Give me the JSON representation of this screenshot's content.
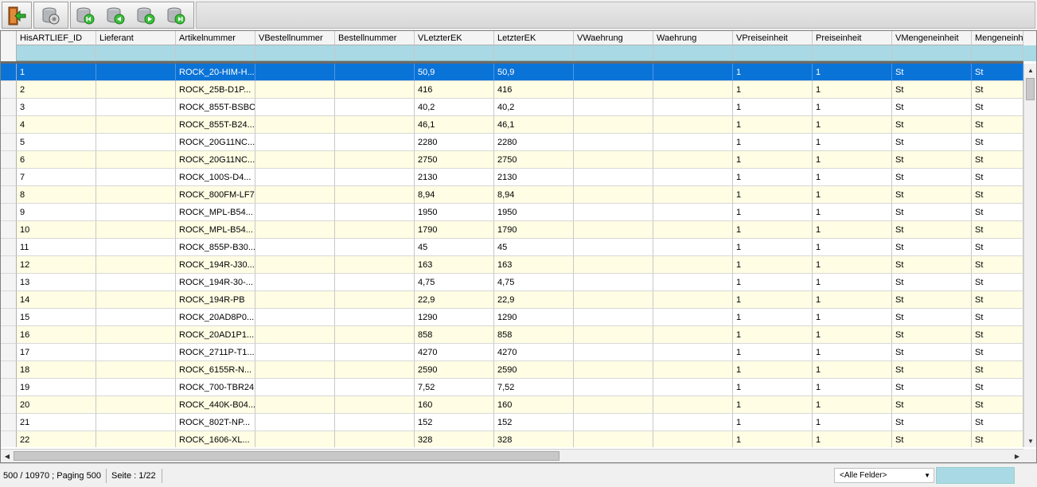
{
  "toolbar": {
    "buttons": [
      {
        "name": "exit-button",
        "icon": "exit-door-icon"
      },
      {
        "name": "settings-db-button",
        "icon": "database-gear-icon"
      },
      {
        "name": "first-page-button",
        "icon": "database-first-icon"
      },
      {
        "name": "previous-page-button",
        "icon": "database-previous-icon"
      },
      {
        "name": "next-page-button",
        "icon": "database-next-icon"
      },
      {
        "name": "last-page-button",
        "icon": "database-last-icon"
      }
    ]
  },
  "grid": {
    "columns": [
      "HisARTLIEF_ID",
      "Lieferant",
      "Artikelnummer",
      "VBestellnummer",
      "Bestellnummer",
      "VLetzterEK",
      "LetzterEK",
      "VWaehrung",
      "Waehrung",
      "VPreiseinheit",
      "Preiseinheit",
      "VMengeneinheit",
      "Mengeneinh"
    ],
    "rows": [
      [
        "1",
        "",
        "ROCK_20-HIM-H...",
        "",
        "",
        "50,9",
        "50,9",
        "",
        "",
        "1",
        "1",
        "St",
        "St"
      ],
      [
        "2",
        "",
        "ROCK_25B-D1P...",
        "",
        "",
        "416",
        "416",
        "",
        "",
        "1",
        "1",
        "St",
        "St"
      ],
      [
        "3",
        "",
        "ROCK_855T-BSBC",
        "",
        "",
        "40,2",
        "40,2",
        "",
        "",
        "1",
        "1",
        "St",
        "St"
      ],
      [
        "4",
        "",
        "ROCK_855T-B24...",
        "",
        "",
        "46,1",
        "46,1",
        "",
        "",
        "1",
        "1",
        "St",
        "St"
      ],
      [
        "5",
        "",
        "ROCK_20G11NC...",
        "",
        "",
        "2280",
        "2280",
        "",
        "",
        "1",
        "1",
        "St",
        "St"
      ],
      [
        "6",
        "",
        "ROCK_20G11NC...",
        "",
        "",
        "2750",
        "2750",
        "",
        "",
        "1",
        "1",
        "St",
        "St"
      ],
      [
        "7",
        "",
        "ROCK_100S-D4...",
        "",
        "",
        "2130",
        "2130",
        "",
        "",
        "1",
        "1",
        "St",
        "St"
      ],
      [
        "8",
        "",
        "ROCK_800FM-LF7",
        "",
        "",
        "8,94",
        "8,94",
        "",
        "",
        "1",
        "1",
        "St",
        "St"
      ],
      [
        "9",
        "",
        "ROCK_MPL-B54...",
        "",
        "",
        "1950",
        "1950",
        "",
        "",
        "1",
        "1",
        "St",
        "St"
      ],
      [
        "10",
        "",
        "ROCK_MPL-B54...",
        "",
        "",
        "1790",
        "1790",
        "",
        "",
        "1",
        "1",
        "St",
        "St"
      ],
      [
        "11",
        "",
        "ROCK_855P-B30...",
        "",
        "",
        "45",
        "45",
        "",
        "",
        "1",
        "1",
        "St",
        "St"
      ],
      [
        "12",
        "",
        "ROCK_194R-J30...",
        "",
        "",
        "163",
        "163",
        "",
        "",
        "1",
        "1",
        "St",
        "St"
      ],
      [
        "13",
        "",
        "ROCK_194R-30-...",
        "",
        "",
        "4,75",
        "4,75",
        "",
        "",
        "1",
        "1",
        "St",
        "St"
      ],
      [
        "14",
        "",
        "ROCK_194R-PB",
        "",
        "",
        "22,9",
        "22,9",
        "",
        "",
        "1",
        "1",
        "St",
        "St"
      ],
      [
        "15",
        "",
        "ROCK_20AD8P0...",
        "",
        "",
        "1290",
        "1290",
        "",
        "",
        "1",
        "1",
        "St",
        "St"
      ],
      [
        "16",
        "",
        "ROCK_20AD1P1...",
        "",
        "",
        "858",
        "858",
        "",
        "",
        "1",
        "1",
        "St",
        "St"
      ],
      [
        "17",
        "",
        "ROCK_2711P-T1...",
        "",
        "",
        "4270",
        "4270",
        "",
        "",
        "1",
        "1",
        "St",
        "St"
      ],
      [
        "18",
        "",
        "ROCK_6155R-N...",
        "",
        "",
        "2590",
        "2590",
        "",
        "",
        "1",
        "1",
        "St",
        "St"
      ],
      [
        "19",
        "",
        "ROCK_700-TBR24",
        "",
        "",
        "7,52",
        "7,52",
        "",
        "",
        "1",
        "1",
        "St",
        "St"
      ],
      [
        "20",
        "",
        "ROCK_440K-B04...",
        "",
        "",
        "160",
        "160",
        "",
        "",
        "1",
        "1",
        "St",
        "St"
      ],
      [
        "21",
        "",
        "ROCK_802T-NP...",
        "",
        "",
        "152",
        "152",
        "",
        "",
        "1",
        "1",
        "St",
        "St"
      ],
      [
        "22",
        "",
        "ROCK_1606-XL...",
        "",
        "",
        "328",
        "328",
        "",
        "",
        "1",
        "1",
        "St",
        "St"
      ]
    ],
    "selected_row": 0
  },
  "statusbar": {
    "count": "500 / 10970 ; Paging 500",
    "page": "Seite : 1/22",
    "field_select": "<Alle Felder>"
  },
  "colors": {
    "selected": "#0a73d8",
    "filter_bg": "#a9d9e4",
    "alt_row": "#fffde4"
  }
}
